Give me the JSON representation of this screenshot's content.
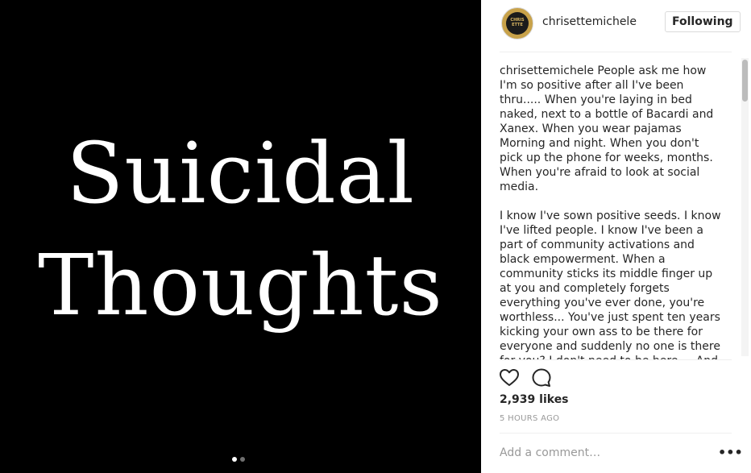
{
  "media": {
    "line1": "Suicidal",
    "line2": "Thoughts",
    "carousel_total": 2,
    "carousel_active": 1
  },
  "header": {
    "username": "chrisettemichele",
    "follow_label": "Following",
    "avatar_text": "CHRIS ETTE"
  },
  "caption": {
    "username": "chrisettemichele",
    "paragraph1": "People ask me how I'm so positive after all I've been thru..... When you're laying in bed naked, next to a bottle of Bacardi and Xanex. When you wear pajamas Morning and night. When you don't pick up the phone for weeks, months. When you're afraid to look at social media.",
    "paragraph2": "I know I've sown positive seeds. I know I've lifted people. I know I've been a part of community activations and black empowerment. When a community sticks its middle finger up at you and completely forgets everything you've ever done, you're worthless... You've just spent ten years kicking your own ass to be there for everyone and suddenly no one is there for you? I don't need to be here.... And when you're already embarrassed over credit"
  },
  "actions": {
    "like_icon": "heart-icon",
    "comment_icon": "comment-icon"
  },
  "stats": {
    "likes": "2,939 likes",
    "time": "5 HOURS AGO"
  },
  "comment": {
    "placeholder": "Add a comment…",
    "more_label": "•••"
  },
  "colors": {
    "text": "#262626",
    "muted": "#999999",
    "border": "#dbdbdb",
    "media_bg": "#000000"
  }
}
